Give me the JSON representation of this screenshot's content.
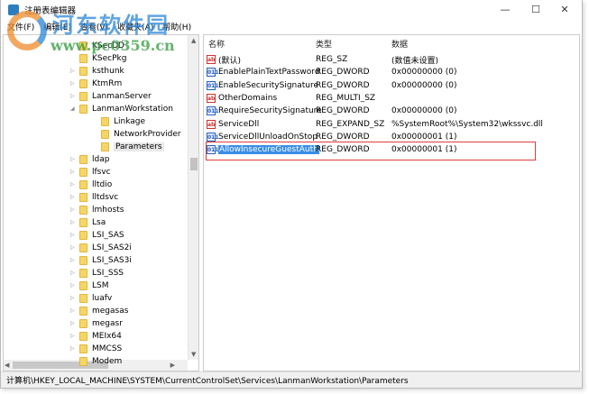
{
  "window": {
    "title": "注册表编辑器"
  },
  "menu": [
    "文件(F)",
    "编辑(E)",
    "查看(V)",
    "收藏夹(A)",
    "帮助(H)"
  ],
  "tree": [
    {
      "label": "KSecDD",
      "level": 1,
      "expander": "none"
    },
    {
      "label": "KSecPkg",
      "level": 1,
      "expander": "none"
    },
    {
      "label": "ksthunk",
      "level": 1,
      "expander": "collapsed"
    },
    {
      "label": "KtmRm",
      "level": 1,
      "expander": "collapsed"
    },
    {
      "label": "LanmanServer",
      "level": 1,
      "expander": "collapsed"
    },
    {
      "label": "LanmanWorkstation",
      "level": 1,
      "expander": "expanded"
    },
    {
      "label": "Linkage",
      "level": 2,
      "expander": "none"
    },
    {
      "label": "NetworkProvider",
      "level": 2,
      "expander": "none"
    },
    {
      "label": "Parameters",
      "level": 2,
      "expander": "none",
      "selected": true
    },
    {
      "label": "ldap",
      "level": 1,
      "expander": "collapsed"
    },
    {
      "label": "lfsvc",
      "level": 1,
      "expander": "collapsed"
    },
    {
      "label": "lltdio",
      "level": 1,
      "expander": "collapsed"
    },
    {
      "label": "lltdsvc",
      "level": 1,
      "expander": "collapsed"
    },
    {
      "label": "lmhosts",
      "level": 1,
      "expander": "collapsed"
    },
    {
      "label": "Lsa",
      "level": 1,
      "expander": "collapsed"
    },
    {
      "label": "LSI_SAS",
      "level": 1,
      "expander": "collapsed"
    },
    {
      "label": "LSI_SAS2i",
      "level": 1,
      "expander": "collapsed"
    },
    {
      "label": "LSI_SAS3i",
      "level": 1,
      "expander": "collapsed"
    },
    {
      "label": "LSI_SSS",
      "level": 1,
      "expander": "collapsed"
    },
    {
      "label": "LSM",
      "level": 1,
      "expander": "collapsed"
    },
    {
      "label": "luafv",
      "level": 1,
      "expander": "collapsed"
    },
    {
      "label": "megasas",
      "level": 1,
      "expander": "collapsed"
    },
    {
      "label": "megasr",
      "level": 1,
      "expander": "collapsed"
    },
    {
      "label": "MEIx64",
      "level": 1,
      "expander": "collapsed"
    },
    {
      "label": "MMCSS",
      "level": 1,
      "expander": "collapsed"
    },
    {
      "label": "Modem",
      "level": 1,
      "expander": "none"
    }
  ],
  "list": {
    "headers": [
      "名称",
      "类型",
      "数据"
    ],
    "rows": [
      {
        "icon": "string-value-icon",
        "name": "(默认)",
        "type": "REG_SZ",
        "data": "(数值未设置)"
      },
      {
        "icon": "binary-value-icon",
        "name": "EnablePlainTextPassword",
        "type": "REG_DWORD",
        "data": "0x00000000 (0)"
      },
      {
        "icon": "binary-value-icon",
        "name": "EnableSecuritySignature",
        "type": "REG_DWORD",
        "data": "0x00000000 (0)"
      },
      {
        "icon": "string-value-icon",
        "name": "OtherDomains",
        "type": "REG_MULTI_SZ",
        "data": ""
      },
      {
        "icon": "binary-value-icon",
        "name": "RequireSecuritySignature",
        "type": "REG_DWORD",
        "data": "0x00000000 (0)"
      },
      {
        "icon": "string-value-icon",
        "name": "ServiceDll",
        "type": "REG_EXPAND_SZ",
        "data": "%SystemRoot%\\System32\\wkssvc.dll"
      },
      {
        "icon": "binary-value-icon",
        "name": "ServiceDllUnloadOnStop",
        "type": "REG_DWORD",
        "data": "0x00000001 (1)"
      },
      {
        "icon": "binary-value-icon",
        "name": "AllowInsecureGuestAuth",
        "type": "REG_DWORD",
        "data": "0x00000001 (1)",
        "selected": true
      }
    ]
  },
  "status": "计算机\\HKEY_LOCAL_MACHINE\\SYSTEM\\CurrentControlSet\\Services\\LanmanWorkstation\\Parameters",
  "watermark": {
    "name": "河东软件园",
    "url": "www.pc0359.cn"
  },
  "colors": {
    "selection": "#3a8ee6",
    "highlight_box": "#e03c3c",
    "folder": "#f7d565"
  }
}
